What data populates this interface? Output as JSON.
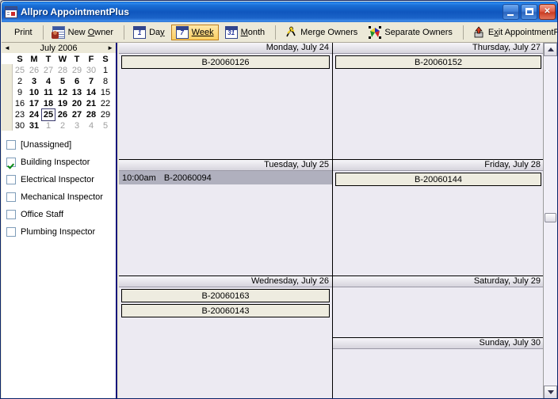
{
  "window": {
    "title": "Allpro AppointmentPlus",
    "icon": "calendar-app-icon",
    "minimize_label": "Minimize",
    "maximize_label": "Maximize",
    "close_label": "Close"
  },
  "toolbar": {
    "print": "Print",
    "new_owner": "New Owner",
    "day": "Day",
    "week": "Week",
    "month": "Month",
    "merge_owners": "Merge Owners",
    "separate_owners": "Separate Owners",
    "exit": "Exit AppointmentPlus",
    "day_icon_number": "1",
    "week_icon_number": "7",
    "month_icon_number": "31",
    "active_view": "Week"
  },
  "mini_calendar": {
    "title": "July 2006",
    "prev_label": "◄",
    "next_label": "►",
    "dow": [
      "S",
      "M",
      "T",
      "W",
      "T",
      "F",
      "S"
    ],
    "selected_day": 25,
    "weeks": [
      [
        {
          "d": 25,
          "m": "prev"
        },
        {
          "d": 26,
          "m": "prev"
        },
        {
          "d": 27,
          "m": "prev"
        },
        {
          "d": 28,
          "m": "prev"
        },
        {
          "d": 29,
          "m": "prev"
        },
        {
          "d": 30,
          "m": "prev"
        },
        {
          "d": 1,
          "m": "cur"
        }
      ],
      [
        {
          "d": 2,
          "m": "cur"
        },
        {
          "d": 3,
          "m": "cur"
        },
        {
          "d": 4,
          "m": "cur"
        },
        {
          "d": 5,
          "m": "cur"
        },
        {
          "d": 6,
          "m": "cur"
        },
        {
          "d": 7,
          "m": "cur"
        },
        {
          "d": 8,
          "m": "cur"
        }
      ],
      [
        {
          "d": 9,
          "m": "cur"
        },
        {
          "d": 10,
          "m": "cur"
        },
        {
          "d": 11,
          "m": "cur"
        },
        {
          "d": 12,
          "m": "cur"
        },
        {
          "d": 13,
          "m": "cur"
        },
        {
          "d": 14,
          "m": "cur"
        },
        {
          "d": 15,
          "m": "cur"
        }
      ],
      [
        {
          "d": 16,
          "m": "cur"
        },
        {
          "d": 17,
          "m": "cur"
        },
        {
          "d": 18,
          "m": "cur"
        },
        {
          "d": 19,
          "m": "cur"
        },
        {
          "d": 20,
          "m": "cur"
        },
        {
          "d": 21,
          "m": "cur"
        },
        {
          "d": 22,
          "m": "cur"
        }
      ],
      [
        {
          "d": 23,
          "m": "cur"
        },
        {
          "d": 24,
          "m": "cur"
        },
        {
          "d": 25,
          "m": "cur"
        },
        {
          "d": 26,
          "m": "cur"
        },
        {
          "d": 27,
          "m": "cur"
        },
        {
          "d": 28,
          "m": "cur"
        },
        {
          "d": 29,
          "m": "cur"
        }
      ],
      [
        {
          "d": 30,
          "m": "cur"
        },
        {
          "d": 31,
          "m": "cur"
        },
        {
          "d": 1,
          "m": "next"
        },
        {
          "d": 2,
          "m": "next"
        },
        {
          "d": 3,
          "m": "next"
        },
        {
          "d": 4,
          "m": "next"
        },
        {
          "d": 5,
          "m": "next"
        }
      ]
    ]
  },
  "owners": [
    {
      "label": "[Unassigned]",
      "checked": false
    },
    {
      "label": "Building Inspector",
      "checked": true
    },
    {
      "label": "Electrical Inspector",
      "checked": false
    },
    {
      "label": "Mechanical Inspector",
      "checked": false
    },
    {
      "label": "Office Staff",
      "checked": false
    },
    {
      "label": "Plumbing Inspector",
      "checked": false
    }
  ],
  "days": [
    {
      "id": "monday",
      "header": "Monday, July 24",
      "column": "left",
      "appointments": [
        {
          "time": "",
          "title": "B-20060126",
          "selected": false
        }
      ]
    },
    {
      "id": "tuesday",
      "header": "Tuesday, July 25",
      "column": "left",
      "appointments": [
        {
          "time": "10:00am",
          "title": "B-20060094",
          "selected": true
        }
      ]
    },
    {
      "id": "wednesday",
      "header": "Wednesday, July 26",
      "column": "left",
      "appointments": [
        {
          "time": "",
          "title": "B-20060163",
          "selected": false
        },
        {
          "time": "",
          "title": "B-20060143",
          "selected": false
        }
      ]
    },
    {
      "id": "thursday",
      "header": "Thursday, July 27",
      "column": "right",
      "appointments": [
        {
          "time": "",
          "title": "B-20060152",
          "selected": false
        }
      ]
    },
    {
      "id": "friday",
      "header": "Friday, July 28",
      "column": "right",
      "appointments": [
        {
          "time": "",
          "title": "B-20060144",
          "selected": false
        }
      ]
    },
    {
      "id": "saturday",
      "header": "Saturday, July 29",
      "column": "right",
      "appointments": []
    },
    {
      "id": "sunday",
      "header": "Sunday, July 30",
      "column": "right",
      "appointments": []
    }
  ],
  "scrollbar": {
    "up_label": "Scroll up",
    "down_label": "Scroll down",
    "thumb_label": "Scroll thumb"
  },
  "colors": {
    "titlebar": "#0f56be",
    "toolbar_bg": "#ece9d8",
    "active_tab": "#fccf63",
    "appointment_bg": "#eeece0",
    "selected_appointment_bg": "#b0b0be",
    "panel_border": "#10107a",
    "calendar_bg": "#eceaf2"
  }
}
